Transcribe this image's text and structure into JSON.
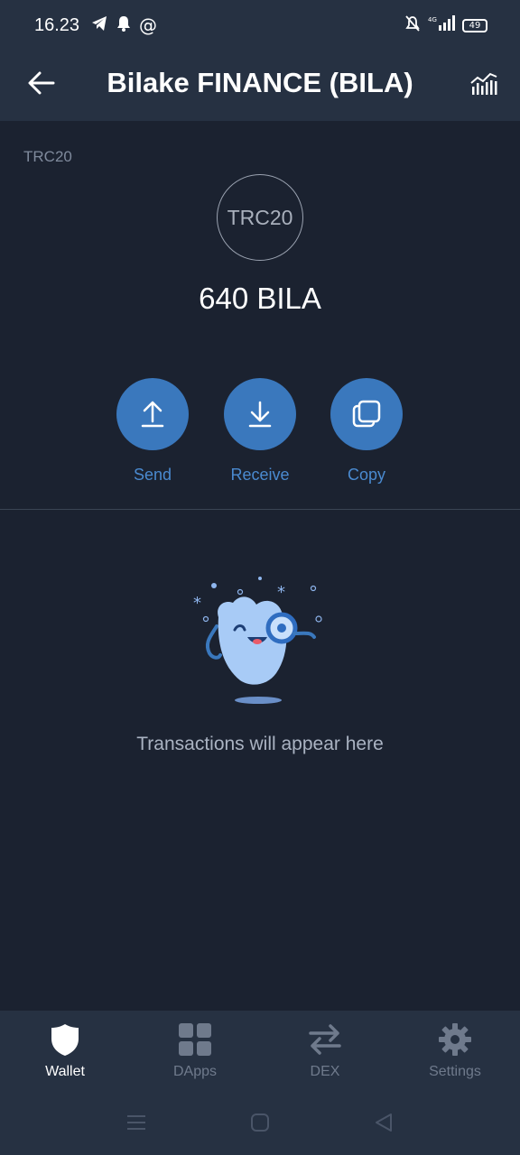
{
  "status_bar": {
    "time": "16.23",
    "battery": "49"
  },
  "header": {
    "title": "Bilake FINANCE (BILA)"
  },
  "token": {
    "standard_label": "TRC20",
    "logo_text": "TRC20",
    "balance": "640 BILA"
  },
  "actions": [
    {
      "label": "Send",
      "icon": "upload-arrow-icon"
    },
    {
      "label": "Receive",
      "icon": "download-arrow-icon"
    },
    {
      "label": "Copy",
      "icon": "copy-icon"
    }
  ],
  "empty_state": {
    "message": "Transactions will appear here"
  },
  "bottom_nav": [
    {
      "label": "Wallet",
      "icon": "shield-icon",
      "active": true
    },
    {
      "label": "DApps",
      "icon": "grid-icon",
      "active": false
    },
    {
      "label": "DEX",
      "icon": "swap-arrows-icon",
      "active": false
    },
    {
      "label": "Settings",
      "icon": "gear-icon",
      "active": false
    }
  ],
  "colors": {
    "background": "#1b2230",
    "header": "#263142",
    "accent": "#3a78bd",
    "accent_text": "#4a8ad0"
  }
}
